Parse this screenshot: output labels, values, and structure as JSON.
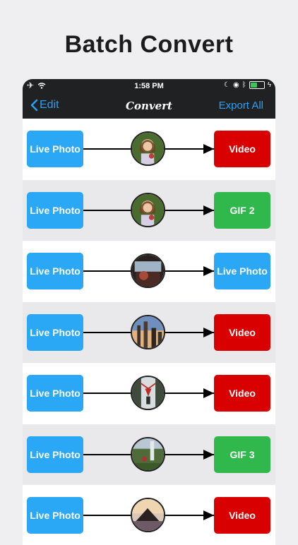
{
  "headline": "Batch Convert",
  "status_bar": {
    "time": "1:58 PM"
  },
  "nav": {
    "back_label": "Edit",
    "title": "Convert",
    "export_label": "Export All"
  },
  "rows": [
    {
      "source": "Live Photo",
      "target": "Video",
      "target_color": "#d80000",
      "thumb": "girl-portrait"
    },
    {
      "source": "Live Photo",
      "target": "GIF 2",
      "target_color": "#30b84c",
      "thumb": "girl-portrait"
    },
    {
      "source": "Live Photo",
      "target": "Live Photo",
      "target_color": "#2aa8f6",
      "thumb": "car-interior"
    },
    {
      "source": "Live Photo",
      "target": "Video",
      "target_color": "#d80000",
      "thumb": "city-sunset"
    },
    {
      "source": "Live Photo",
      "target": "Video",
      "target_color": "#d80000",
      "thumb": "waterfall-person"
    },
    {
      "source": "Live Photo",
      "target": "GIF 3",
      "target_color": "#30b84c",
      "thumb": "waterfall-hike"
    },
    {
      "source": "Live Photo",
      "target": "Video",
      "target_color": "#d80000",
      "thumb": "mountain-sunset"
    }
  ]
}
